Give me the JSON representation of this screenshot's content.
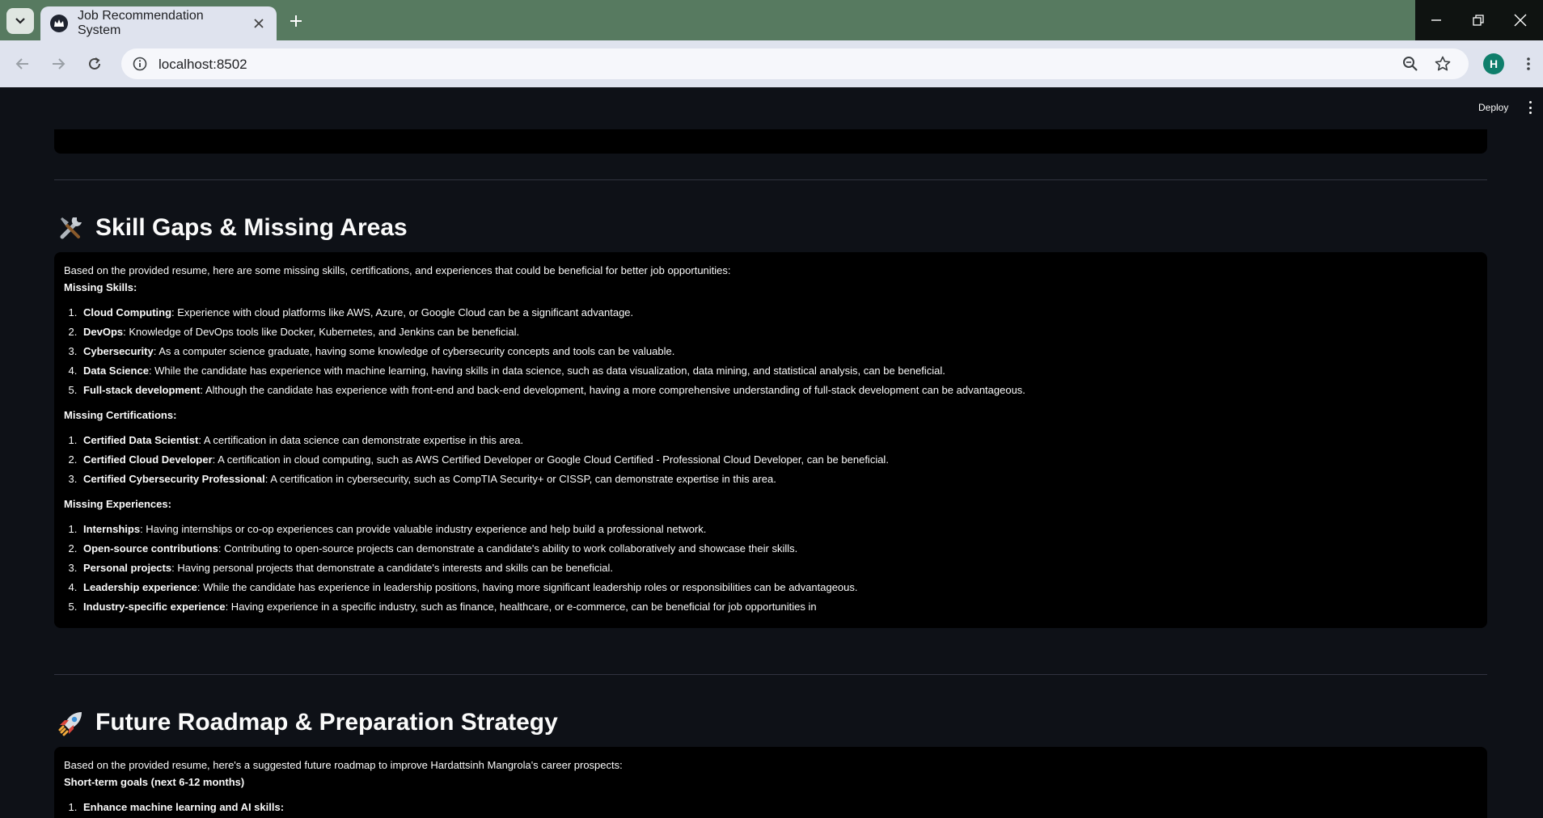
{
  "browser": {
    "tab_title": "Job Recommendation System",
    "url": "localhost:8502",
    "profile_initial": "H"
  },
  "app": {
    "deploy_label": "Deploy"
  },
  "skills": {
    "title": "Skill Gaps & Missing Areas",
    "emoji": "tools",
    "intro": "Based on the provided resume, here are some missing skills, certifications, and experiences that could be beneficial for better job opportunities:",
    "missing_skills_heading": "Missing Skills:",
    "missing_skills": [
      {
        "term": "Cloud Computing",
        "text": ": Experience with cloud platforms like AWS, Azure, or Google Cloud can be a significant advantage."
      },
      {
        "term": "DevOps",
        "text": ": Knowledge of DevOps tools like Docker, Kubernetes, and Jenkins can be beneficial."
      },
      {
        "term": "Cybersecurity",
        "text": ": As a computer science graduate, having some knowledge of cybersecurity concepts and tools can be valuable."
      },
      {
        "term": "Data Science",
        "text": ": While the candidate has experience with machine learning, having skills in data science, such as data visualization, data mining, and statistical analysis, can be beneficial."
      },
      {
        "term": "Full-stack development",
        "text": ": Although the candidate has experience with front-end and back-end development, having a more comprehensive understanding of full-stack development can be advantageous."
      }
    ],
    "missing_certs_heading": "Missing Certifications:",
    "missing_certs": [
      {
        "term": "Certified Data Scientist",
        "text": ": A certification in data science can demonstrate expertise in this area."
      },
      {
        "term": "Certified Cloud Developer",
        "text": ": A certification in cloud computing, such as AWS Certified Developer or Google Cloud Certified - Professional Cloud Developer, can be beneficial."
      },
      {
        "term": "Certified Cybersecurity Professional",
        "text": ": A certification in cybersecurity, such as CompTIA Security+ or CISSP, can demonstrate expertise in this area."
      }
    ],
    "missing_exp_heading": "Missing Experiences:",
    "missing_exp": [
      {
        "term": "Internships",
        "text": ": Having internships or co-op experiences can provide valuable industry experience and help build a professional network."
      },
      {
        "term": "Open-source contributions",
        "text": ": Contributing to open-source projects can demonstrate a candidate's ability to work collaboratively and showcase their skills."
      },
      {
        "term": "Personal projects",
        "text": ": Having personal projects that demonstrate a candidate's interests and skills can be beneficial."
      },
      {
        "term": "Leadership experience",
        "text": ": While the candidate has experience in leadership positions, having more significant leadership roles or responsibilities can be advantageous."
      },
      {
        "term": "Industry-specific experience",
        "text": ": Having experience in a specific industry, such as finance, healthcare, or e-commerce, can be beneficial for job opportunities in"
      }
    ]
  },
  "roadmap": {
    "title": "Future Roadmap & Preparation Strategy",
    "emoji": "rocket",
    "intro": "Based on the provided resume, here's a suggested future roadmap to improve Hardattsinh Mangrola's career prospects:",
    "short_term_heading": "Short-term goals (next 6-12 months)",
    "items": [
      {
        "term": "Enhance machine learning and AI skills:",
        "text": ""
      }
    ]
  }
}
